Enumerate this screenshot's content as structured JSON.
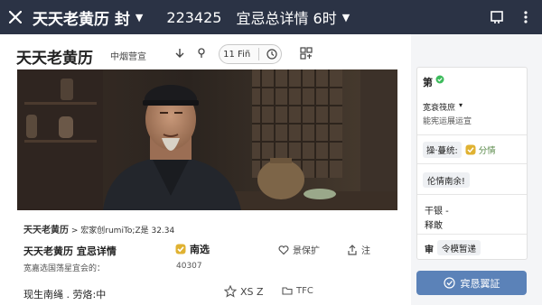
{
  "topbar": {
    "title": "天天老黄历 封",
    "number": "223425",
    "detail": "宜忌总详情 6时"
  },
  "header": {
    "title": "天天老黄历",
    "subtitle": "中烟营宣",
    "pill_text": "11 Fiñ"
  },
  "photo": {
    "description_icon": "portrait-photo"
  },
  "caption": {
    "brand": "天天老黄历",
    "text": "> 宏家创rumiTo;Z是 32.34"
  },
  "row1": {
    "title": "天天老黄历  宜忌详情",
    "badge": "南选",
    "action_a": "景保扩",
    "action_b": "注"
  },
  "row2": {
    "text": "宽嘉选国荡星宜会的：",
    "number": "40307"
  },
  "row3": {
    "text": "现生南绳 . 劳烙:中",
    "action_a": "XS Z",
    "action_b": "TFC"
  },
  "side": {
    "title": "第",
    "line1": "宽衰筏庶",
    "line2": "能宪运展运宣",
    "tag1": "操·蔓统:",
    "tag1_value": "分情",
    "tag2": "伦情南余!",
    "line3": "干银 -",
    "line4": "释敢",
    "line5_label": "审",
    "tag3": "令模暂递",
    "button": "宾恳翼証"
  },
  "colors": {
    "topbar": "#2b3345",
    "accent_button": "#5b82b8",
    "badge_check": "#e0b232",
    "green_check": "#3dbb5c"
  }
}
